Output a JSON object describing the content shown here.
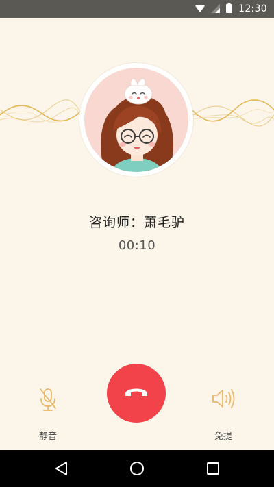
{
  "status_bar": {
    "time": "12:30",
    "icons": [
      "wifi-icon",
      "signal-icon",
      "battery-icon"
    ]
  },
  "call": {
    "caller_name": "咨询师：萧毛驴",
    "duration": "00:10"
  },
  "controls": {
    "mute_label": "静音",
    "speaker_label": "免提",
    "hangup_icon": "phone-hangup-icon"
  },
  "nav_bar": {
    "icons": [
      "back-icon",
      "home-icon",
      "recents-icon"
    ]
  },
  "colors": {
    "background": "#fcf5ea",
    "status_bar": "#5b5954",
    "hangup": "#f2434b",
    "accent_icon": "#e9b86a",
    "wave": "#e0b24a"
  }
}
